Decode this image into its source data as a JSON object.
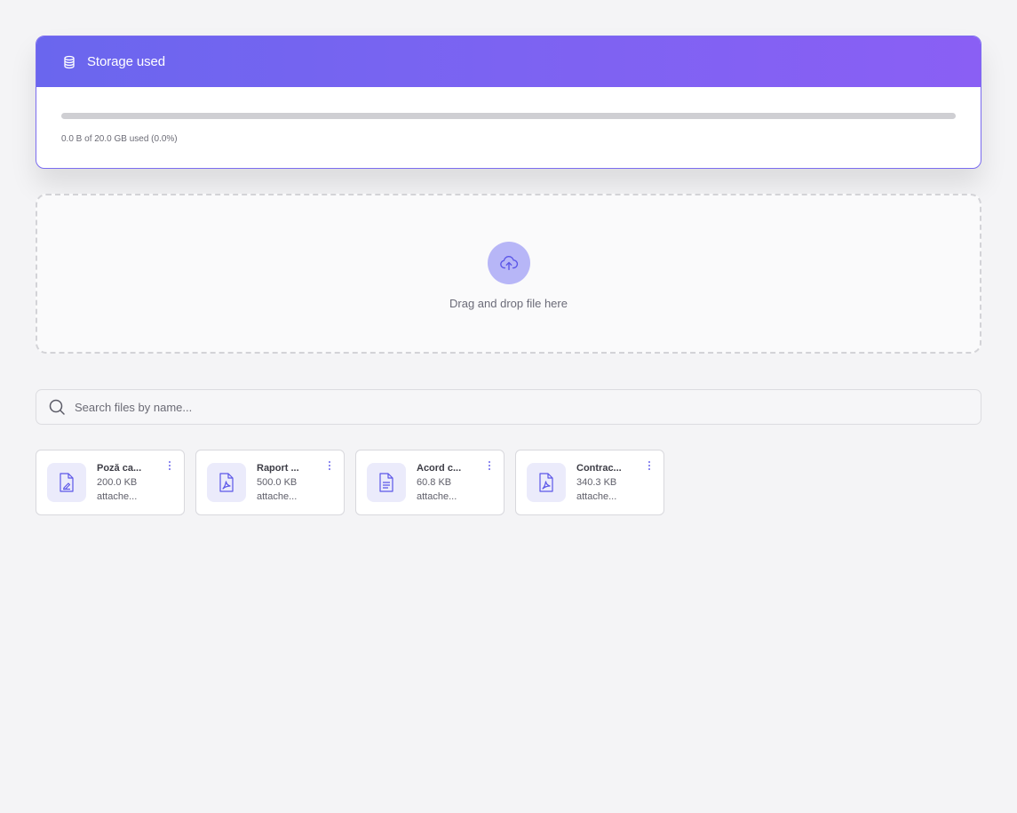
{
  "storage": {
    "title": "Storage used",
    "icon": "database-icon",
    "used_fraction": 0.0,
    "summary": "0.0 B of 20.0 GB used (0.0%)",
    "accent_color": "#6a66ee"
  },
  "dropzone": {
    "icon": "cloud-upload-icon",
    "label": "Drag and drop file here"
  },
  "search": {
    "icon": "search-icon",
    "placeholder": "Search files by name...",
    "value": ""
  },
  "files": [
    {
      "name": "Poză ca...",
      "size": "200.0 KB",
      "meta": "attache...",
      "icon": "image-file-icon"
    },
    {
      "name": "Raport ...",
      "size": "500.0 KB",
      "meta": "attache...",
      "icon": "pdf-file-icon"
    },
    {
      "name": "Acord c...",
      "size": "60.8 KB",
      "meta": "attache...",
      "icon": "text-file-icon"
    },
    {
      "name": "Contrac...",
      "size": "340.3 KB",
      "meta": "attache...",
      "icon": "pdf-file-icon"
    }
  ]
}
